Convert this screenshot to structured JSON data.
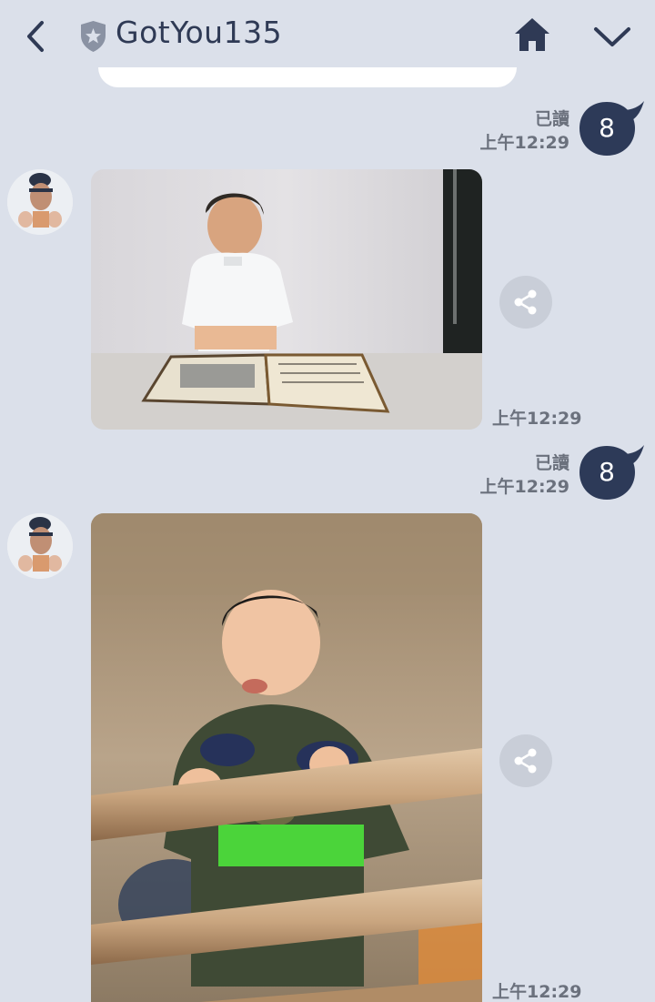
{
  "header": {
    "title": "GotYou135"
  },
  "messages": [
    {
      "read_label": "已讀",
      "read_time": "上午12:29",
      "badge": "8"
    },
    {
      "time": "上午12:29"
    },
    {
      "read_label": "已讀",
      "read_time": "上午12:29",
      "badge": "8"
    },
    {
      "time": "上午12:29"
    }
  ],
  "colors": {
    "background": "#dbe0ea",
    "accent_dark": "#2f3a55",
    "badge": "#2d3a58",
    "meta_text": "#6b717d"
  }
}
